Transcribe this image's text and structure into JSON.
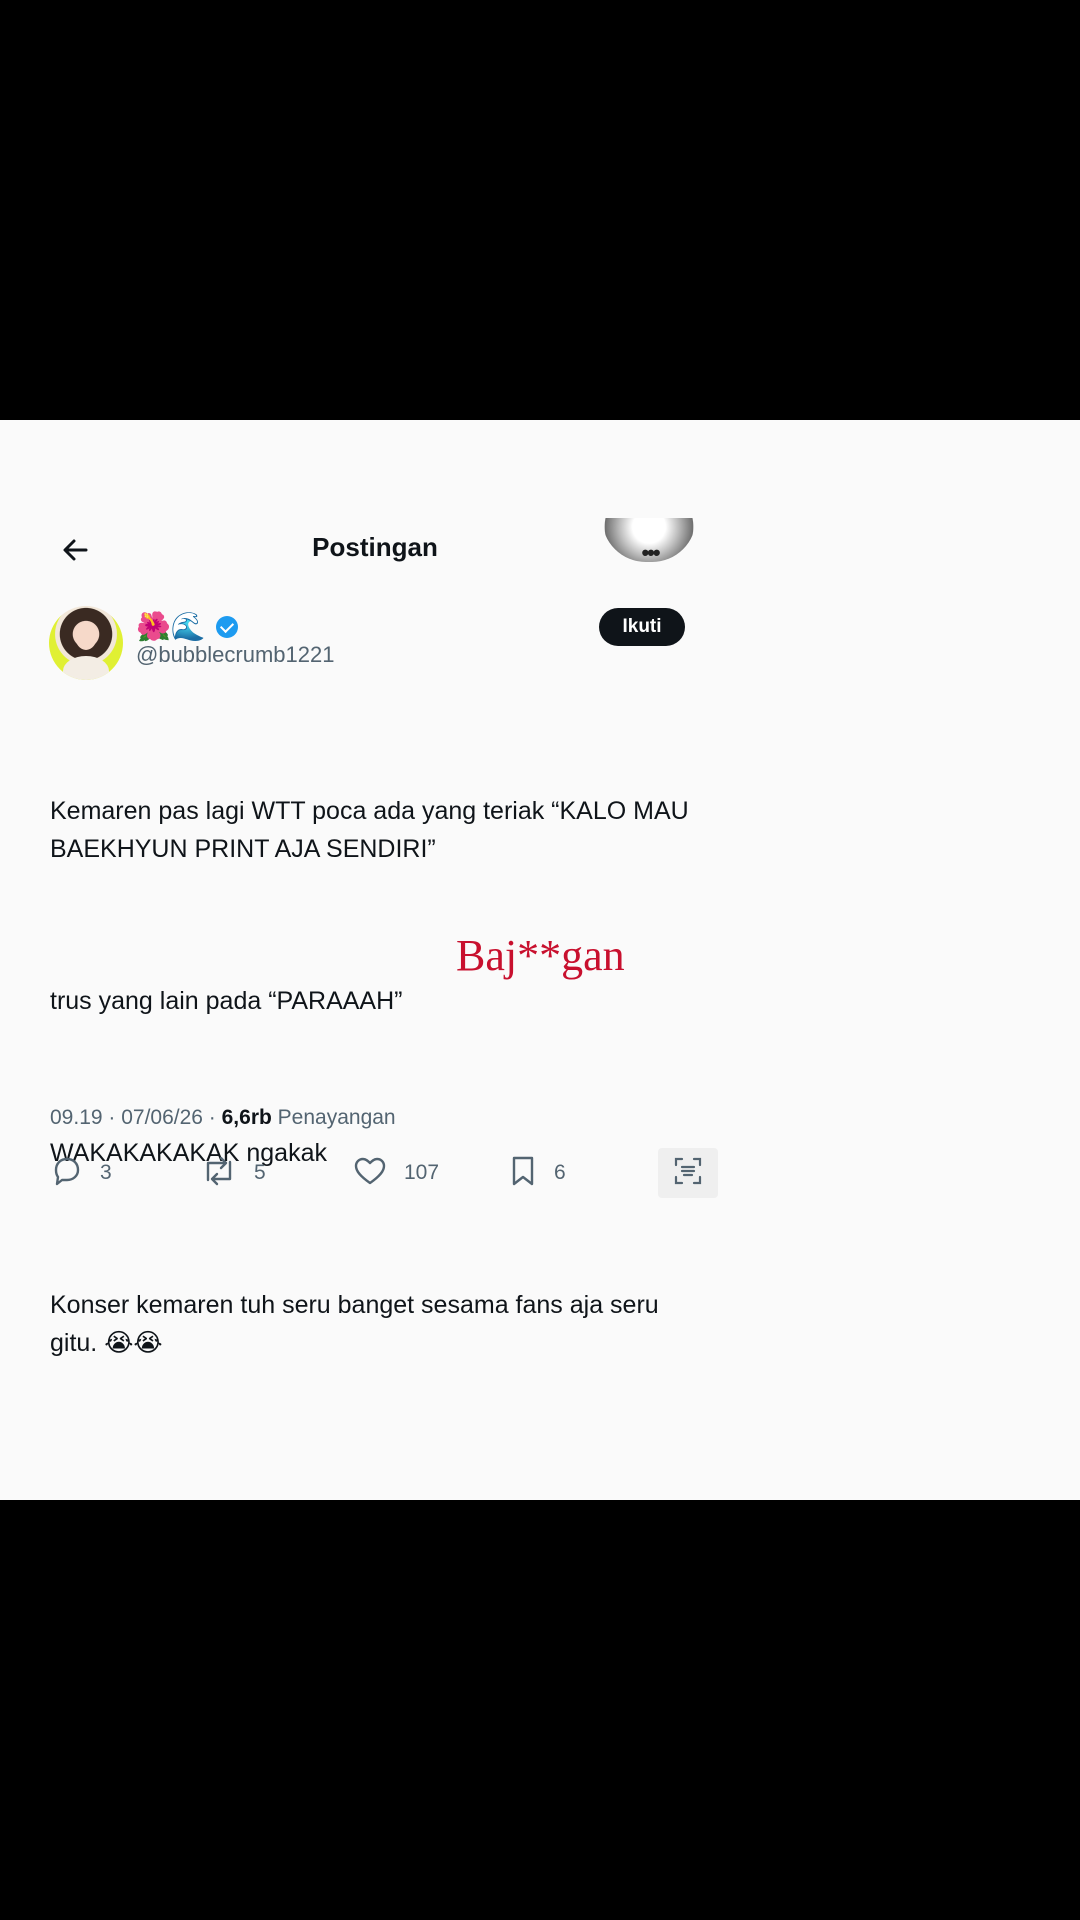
{
  "header": {
    "title": "Postingan",
    "more_label": "•••"
  },
  "author": {
    "name_emojis": "🌺🌊",
    "handle": "@bubblecrumb1221",
    "follow_label": "Ikuti"
  },
  "tweet": {
    "paragraphs": [
      "Kemaren pas lagi WTT poca ada yang teriak “KALO MAU BAEKHYUN PRINT AJA SENDIRI”",
      "trus yang lain pada “PARAAAH”",
      "WAKAKAKAKAK ngakak",
      "Konser kemaren tuh seru banget sesama fans aja seru gitu. 😭😭"
    ]
  },
  "overlay_text": "Baj**gan",
  "meta": {
    "time_date": "09.19 · 07/06/26 · ",
    "views_count": "6,6rb",
    "views_label": " Penayangan"
  },
  "actions": {
    "replies": "3",
    "reposts": "5",
    "likes": "107",
    "bookmarks": "6"
  },
  "colors": {
    "verified": "#1d9bf0",
    "overlay": "#c8102e",
    "follow_bg": "#0f1419"
  }
}
